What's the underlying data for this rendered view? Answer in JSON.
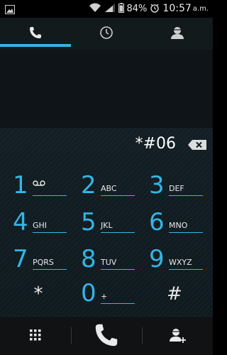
{
  "status_bar": {
    "battery_percent": "84%",
    "time": "10:57",
    "ampm": "a.m."
  },
  "tabs": [
    {
      "name": "phone",
      "icon": "phone-icon",
      "selected": true
    },
    {
      "name": "recent",
      "icon": "clock-icon",
      "selected": false
    },
    {
      "name": "contacts",
      "icon": "contact-icon",
      "selected": false
    }
  ],
  "dial": {
    "digits": "*#06"
  },
  "keys": [
    {
      "digit": "1",
      "letters": "∞"
    },
    {
      "digit": "2",
      "letters": "ABC"
    },
    {
      "digit": "3",
      "letters": "DEF"
    },
    {
      "digit": "4",
      "letters": "GHI"
    },
    {
      "digit": "5",
      "letters": "JKL"
    },
    {
      "digit": "6",
      "letters": "MNO"
    },
    {
      "digit": "7",
      "letters": "PQRS"
    },
    {
      "digit": "8",
      "letters": "TUV"
    },
    {
      "digit": "9",
      "letters": "WXYZ"
    },
    {
      "digit": "*",
      "letters": ""
    },
    {
      "digit": "0",
      "letters": "+"
    },
    {
      "digit": "#",
      "letters": ""
    }
  ],
  "bottom_bar": {
    "left_icon": "dialpad-icon",
    "center_icon": "call-icon",
    "right_icon": "add-contact-icon"
  },
  "colors": {
    "accent": "#33b5e5",
    "background": "#0f1a1f"
  }
}
